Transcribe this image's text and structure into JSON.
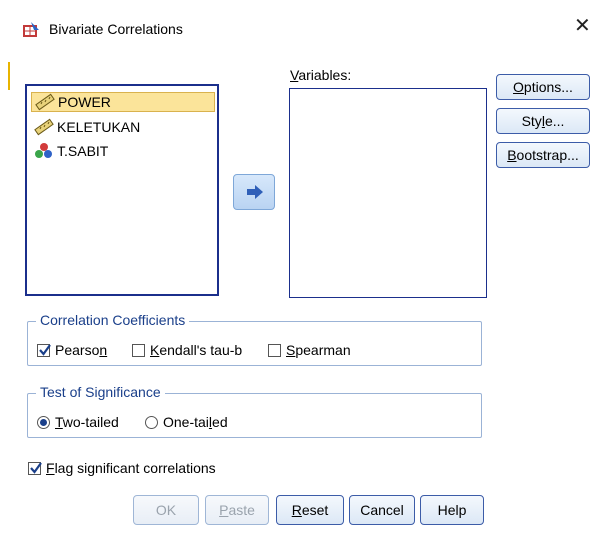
{
  "window": {
    "title": "Bivariate Correlations",
    "close_glyph": "✕",
    "icon": "correlations-app-icon"
  },
  "source_list": {
    "items": [
      {
        "label": "POWER",
        "icon": "ruler-scale-icon",
        "selected": true
      },
      {
        "label": "KELETUKAN",
        "icon": "ruler-scale-icon",
        "selected": false
      },
      {
        "label": "T.SABIT",
        "icon": "nominal-balls-icon",
        "selected": false
      }
    ]
  },
  "move_button": {
    "icon": "right-arrow-icon"
  },
  "variables": {
    "label": "Variables:",
    "mnemonic": "V",
    "rest": "ariables:"
  },
  "side_buttons": {
    "options": {
      "pre": "",
      "u": "O",
      "post": "ptions..."
    },
    "style": {
      "pre": "Sty",
      "u": "l",
      "post": "e..."
    },
    "bootstrap": {
      "pre": "",
      "u": "B",
      "post": "ootstrap..."
    }
  },
  "correlation": {
    "title": "Correlation Coefficients",
    "pearson": {
      "pre": "Pearso",
      "u": "n",
      "post": "",
      "checked": true
    },
    "kendall": {
      "pre": "",
      "u": "K",
      "post": "endall's tau-b",
      "checked": false
    },
    "spearman": {
      "pre": "",
      "u": "S",
      "post": "pearman",
      "checked": false
    }
  },
  "significance": {
    "title": "Test of Significance",
    "two_tailed": {
      "pre": "",
      "u": "T",
      "post": "wo-tailed",
      "selected": true
    },
    "one_tailed": {
      "pre": "One-tai",
      "u": "l",
      "post": "ed",
      "selected": false
    }
  },
  "flag": {
    "pre": "",
    "u": "F",
    "post": "lag significant correlations",
    "checked": true
  },
  "bottom_buttons": {
    "ok": {
      "label": "OK",
      "disabled": true
    },
    "paste": {
      "pre": "",
      "u": "P",
      "post": "aste",
      "disabled": true
    },
    "reset": {
      "pre": "",
      "u": "R",
      "post": "eset",
      "disabled": false
    },
    "cancel": {
      "label": "Cancel",
      "disabled": false
    },
    "help": {
      "label": "Help",
      "disabled": false
    }
  },
  "colors": {
    "accent": "#1a3f8a",
    "list_border": "#1b2f8c",
    "selection": "#fbe49a"
  }
}
